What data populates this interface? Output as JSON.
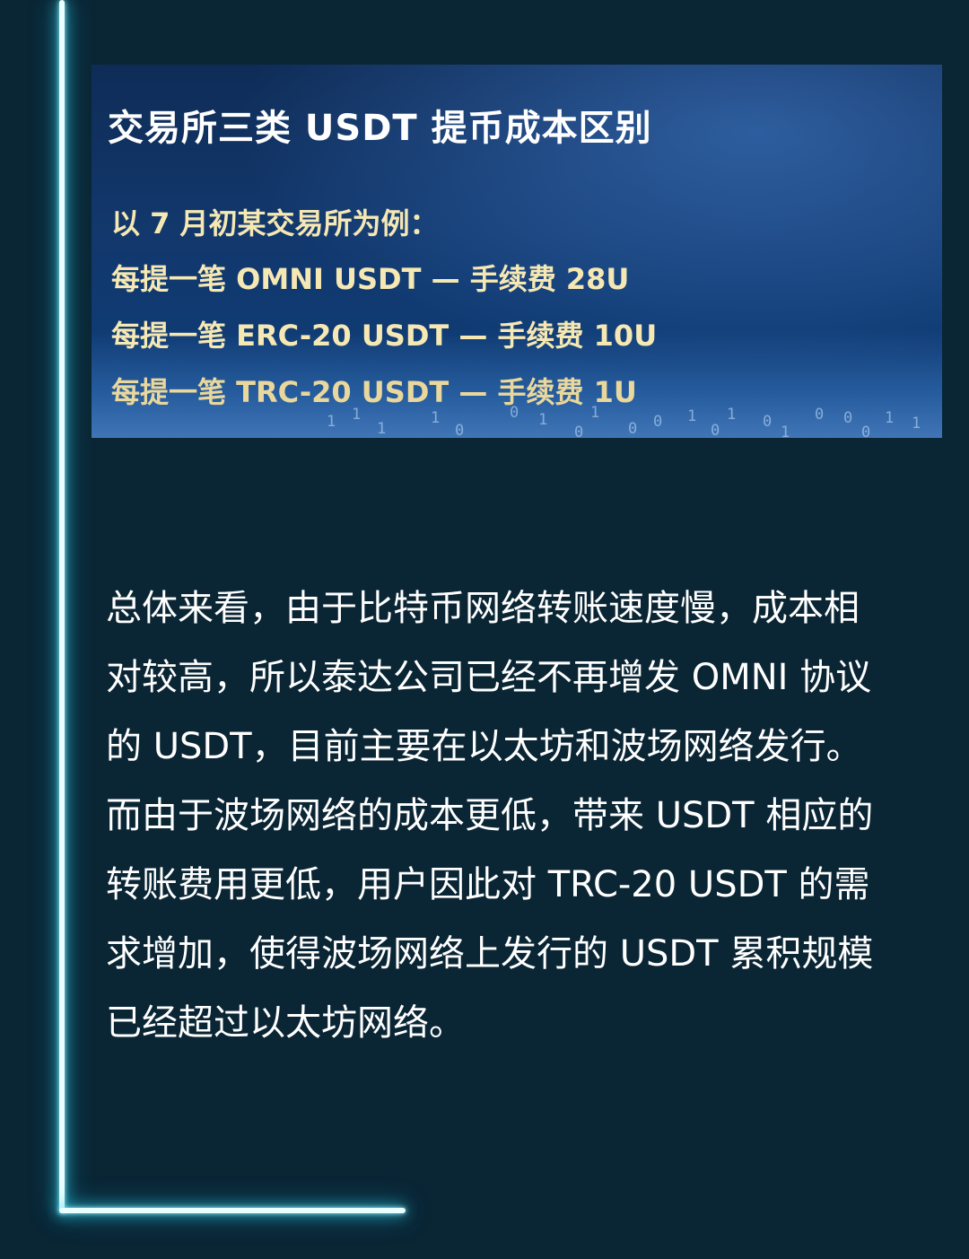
{
  "banner": {
    "title": "交易所三类 USDT 提币成本区别",
    "intro": "以 7 月初某交易所为例：",
    "fees": [
      "每提一笔 OMNI USDT — 手续费 28U",
      "每提一笔 ERC-20 USDT — 手续费 10U",
      "每提一笔 TRC-20 USDT — 手续费 1U"
    ],
    "binary_digits": [
      "1",
      "1",
      "1",
      "1",
      "0",
      "0",
      "1",
      "0",
      "1",
      "0",
      "0",
      "1",
      "0",
      "1",
      "0",
      "1",
      "0",
      "0",
      "0",
      "1",
      "1"
    ]
  },
  "article": {
    "paragraph": "总体来看，由于比特币网络转账速度慢，成本相对较高，所以泰达公司已经不再增发 OMNI 协议的 USDT，目前主要在以太坊和波场网络发行。而由于波场网络的成本更低，带来 USDT 相应的转账费用更低，用户因此对 TRC-20 USDT 的需求增加，使得波场网络上发行的 USDT 累积规模已经超过以太坊网络。"
  },
  "colors": {
    "page_background": "#0a2534",
    "glow_line": "#34d6f0",
    "banner_title": "#ffffff",
    "banner_text": "#f6e8b3",
    "body_text": "#ffffff"
  }
}
